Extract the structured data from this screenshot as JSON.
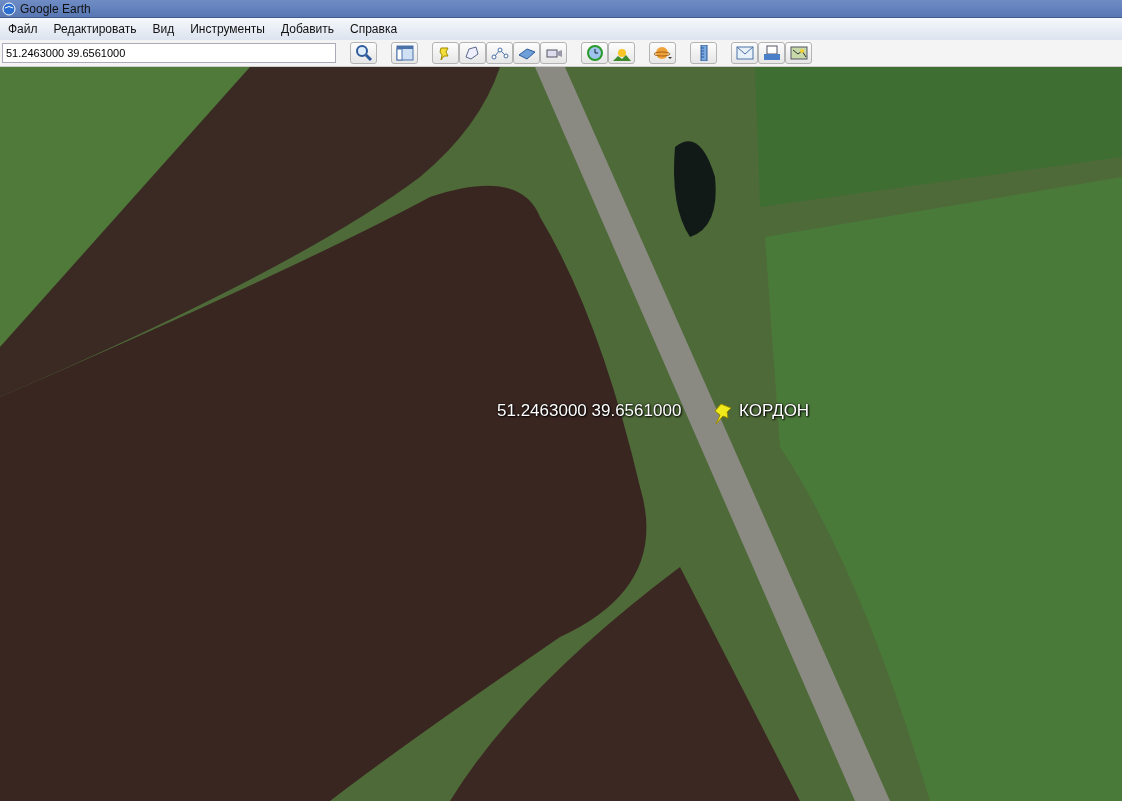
{
  "window": {
    "title": "Google Earth"
  },
  "menu": [
    "Файл",
    "Редактировать",
    "Вид",
    "Инструменты",
    "Добавить",
    "Справка"
  ],
  "search": {
    "value": "51.2463000 39.6561000"
  },
  "map": {
    "labels": [
      {
        "kind": "coordinates",
        "text": "51.2463000 39.6561000"
      },
      {
        "kind": "placemark",
        "text": "КОРДОН"
      }
    ]
  }
}
